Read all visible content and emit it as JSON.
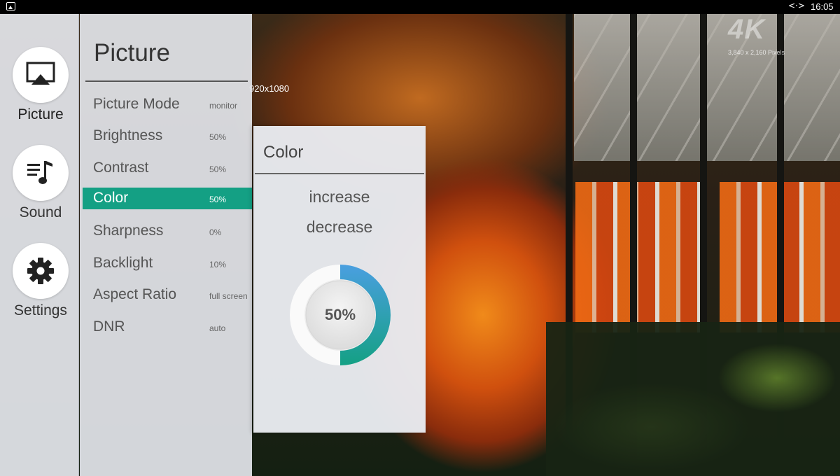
{
  "status_bar": {
    "nav_glyph": "<·>",
    "time": "16:05"
  },
  "video": {
    "logo": "4K",
    "pixels": "3,840 x 2,160 Pixels",
    "resolution_overlay": "920x1080"
  },
  "rail": {
    "items": [
      {
        "label": "Picture",
        "icon": "airplay-screen-icon"
      },
      {
        "label": "Sound",
        "icon": "music-list-icon"
      },
      {
        "label": "Settings",
        "icon": "gear-icon"
      }
    ]
  },
  "panel": {
    "title": "Picture",
    "items": [
      {
        "name": "Picture Mode",
        "value": "monitor"
      },
      {
        "name": "Brightness",
        "value": "50%"
      },
      {
        "name": "Contrast",
        "value": "50%"
      },
      {
        "name": "Color",
        "value": "50%",
        "selected": true
      },
      {
        "name": "Sharpness",
        "value": "0%"
      },
      {
        "name": "Backlight",
        "value": "10%"
      },
      {
        "name": "Aspect Ratio",
        "value": "full screen"
      },
      {
        "name": "DNR",
        "value": "auto"
      }
    ]
  },
  "popup": {
    "title": "Color",
    "increase_label": "increase",
    "decrease_label": "decrease",
    "dial_label": "50%",
    "level": 0.5,
    "colors": {
      "arc_start": "#4a9fe0",
      "arc_end": "#14a084"
    }
  },
  "colors": {
    "accent": "#14a084"
  }
}
